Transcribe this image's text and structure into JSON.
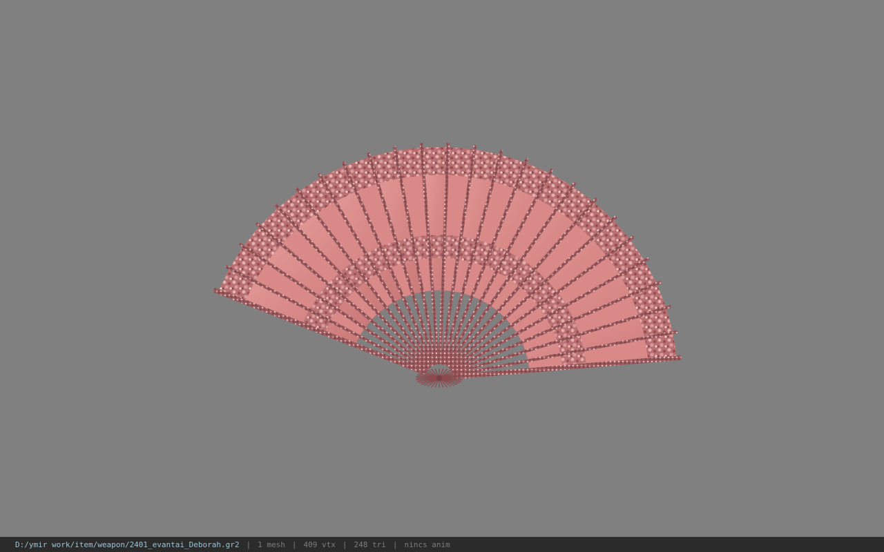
{
  "viewer": {
    "background_color": "#808080",
    "model": {
      "type": "folding-fan",
      "rib_count": 25,
      "paper_color": "#d98a88",
      "lace_color": "#a85c5e",
      "rib_color": "#8a4a4e"
    }
  },
  "status_bar": {
    "file_path": "D:/ymir work/item/weapon/2401_evantai_Deborah.gr2",
    "separator": "|",
    "mesh_count": "1 mesh",
    "vertex_count": "409 vtx",
    "triangle_count": "248 tri",
    "animation": "nincs anim"
  }
}
